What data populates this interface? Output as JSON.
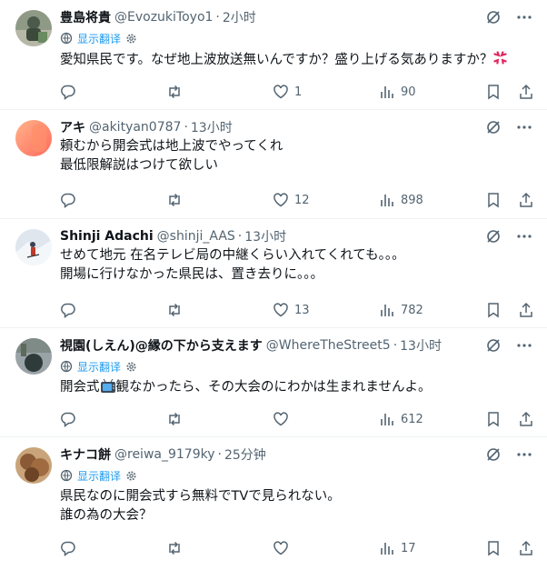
{
  "colors": {
    "accent": "#1d9bf0",
    "muted": "#536471",
    "text": "#0f1419",
    "divider": "#eff3f4"
  },
  "icons": [
    "reply-icon",
    "retweet-icon",
    "like-icon",
    "views-icon",
    "bookmark-icon",
    "share-icon",
    "grok-icon",
    "more-icon",
    "translate-globe-icon",
    "gear-icon"
  ],
  "tweets": [
    {
      "name": "豊島将貴",
      "handle": "@EvozukiToyo1",
      "sep": "·",
      "time": "2小时",
      "translate_label": "显示翻译",
      "text_main": "愛知県民です。なぜ地上波放送無いんですか？盛り上げる気ありますか？",
      "emoji": "anger-emoji",
      "replies": "",
      "retweets": "",
      "likes": "1",
      "views": "90"
    },
    {
      "name": "アキ",
      "handle": "@akityan0787",
      "sep": "·",
      "time": "13小时",
      "text_line1": "頼むから開会式は地上波でやってくれ",
      "text_line2": "最低限解説はつけて欲しい",
      "replies": "",
      "retweets": "",
      "likes": "12",
      "views": "898"
    },
    {
      "name": "Shinji Adachi",
      "handle": "@shinji_AAS",
      "sep": "·",
      "time": "13小时",
      "text_line1": "せめて地元 在名テレビ局の中継くらい入れてくれても。。。",
      "text_line2": "開場に行けなかった県民は、置き去りに。。。",
      "replies": "",
      "retweets": "",
      "likes": "13",
      "views": "782"
    },
    {
      "name": "視園(しえん)@縁の下から支えます",
      "handle": "@WhereTheStreet5",
      "sep": "·",
      "time": "13小时",
      "translate_label": "显示翻译",
      "text_before": "開会式",
      "text_after": "観なかったら、その大会のにわかは生まれませんよ。",
      "replies": "",
      "retweets": "",
      "likes": "",
      "views": "612"
    },
    {
      "name": "キナコ餅",
      "handle": "@reiwa_9179ky",
      "sep": "·",
      "time": "25分钟",
      "translate_label": "显示翻译",
      "text_line1": "県民なのに開会式すら無料でTVで見られない。",
      "text_line2": "誰の為の大会？",
      "replies": "",
      "retweets": "",
      "likes": "",
      "views": "17"
    }
  ]
}
